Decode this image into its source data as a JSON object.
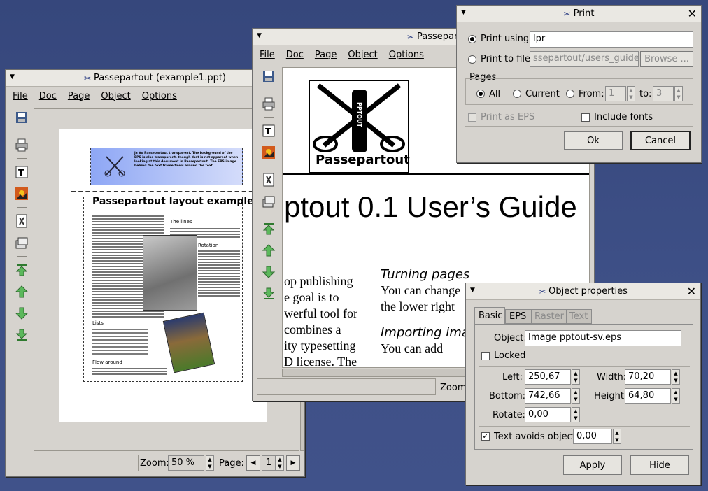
{
  "win1": {
    "title": "Passepartout (example1.ppt)",
    "menu": [
      "File",
      "Doc",
      "Page",
      "Object",
      "Options"
    ],
    "doc": {
      "heading": "Passepartout layout example",
      "banner": "Ja Vo Passepartout transparent. The background of the EPS is also transparent, though that is not apparent when looking at this document in Passepartout. The EPS image behind the text frame flows around the text.",
      "col_title_lines": "The lines",
      "col_title_rotation": "Rotation",
      "col_title_lists": "Lists",
      "col_title_flow": "Flow around"
    },
    "zoom_label": "Zoom:",
    "zoom_value": "50 %",
    "page_label": "Page:",
    "page_value": "1"
  },
  "win2": {
    "title": "Passepartout (users_gu",
    "menu": [
      "File",
      "Doc",
      "Page",
      "Object",
      "Options"
    ],
    "doc": {
      "logo_text": "Passepartout",
      "logo_vertical": "PPTOUT",
      "big_title": "ptout 0.1 User’s Guide",
      "left_lines": [
        "op publishing",
        "e goal is to",
        "werful tool for",
        "combines a",
        "ity typesetting",
        "D license. The"
      ],
      "subhead1": "Turning pages",
      "right_line1": "You can change",
      "right_line2": "the lower right",
      "subhead2": "Importing imag",
      "right_line3": "You can add"
    },
    "zoom_label": "Zoom:"
  },
  "print": {
    "title": "Print",
    "print_using_label": "Print using:",
    "print_using_value": "lpr",
    "print_to_file_label": "Print to file:",
    "print_to_file_value": "ssepartout/users_guide.ps",
    "browse": "Browse ...",
    "pages_label": "Pages",
    "all": "All",
    "current": "Current",
    "from": "From:",
    "from_value": "1",
    "to": "to:",
    "to_value": "3",
    "print_as_eps": "Print as EPS",
    "include_fonts": "Include fonts",
    "ok": "Ok",
    "cancel": "Cancel"
  },
  "props": {
    "title": "Object properties",
    "tabs": [
      "Basic",
      "EPS",
      "Raster",
      "Text"
    ],
    "object_label": "Object:",
    "object_value": "Image pptout-sv.eps",
    "locked": "Locked",
    "left_label": "Left:",
    "left_value": "250,67",
    "width_label": "Width:",
    "width_value": "70,20",
    "bottom_label": "Bottom:",
    "bottom_value": "742,66",
    "height_label": "Height:",
    "height_value": "64,80",
    "rotate_label": "Rotate:",
    "rotate_value": "0,00",
    "text_avoids": "Text avoids object",
    "text_avoids_value": "0,00",
    "apply": "Apply",
    "hide": "Hide"
  }
}
